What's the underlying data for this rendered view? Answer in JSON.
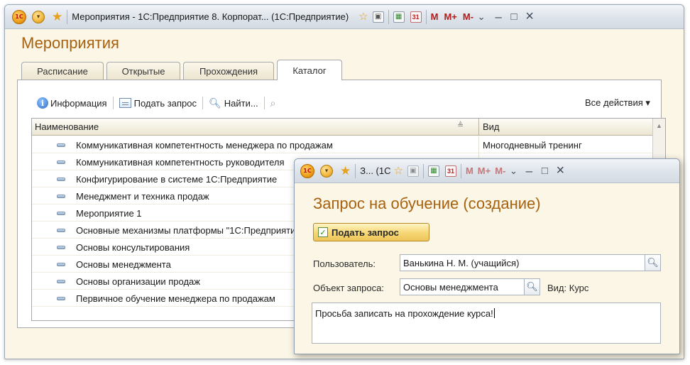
{
  "main_window": {
    "title": "Мероприятия - 1С:Предприятие 8. Корпорат...  (1С:Предприятие)",
    "logo_text": "1С",
    "toolbar_icons": [
      "calculator-icon",
      "calendar-icon"
    ],
    "memory": {
      "m": "M",
      "m_plus": "M+",
      "m_minus": "M-"
    },
    "window_controls": {
      "dropdown": "⌄",
      "minimize": "–",
      "maximize": "□",
      "close": "×"
    }
  },
  "page": {
    "title": "Мероприятия",
    "tabs": [
      {
        "label": "Расписание",
        "active": false
      },
      {
        "label": "Открытые",
        "active": false
      },
      {
        "label": "Прохождения",
        "active": false
      },
      {
        "label": "Каталог",
        "active": true
      }
    ]
  },
  "toolbar": {
    "info_label": "Информация",
    "request_label": "Подать запрос",
    "find_label": "Найти...",
    "all_actions_label": "Все действия ▾"
  },
  "grid": {
    "columns": {
      "name": "Наименование",
      "kind": "Вид"
    },
    "rows": [
      {
        "name": "Коммуникативная компетентность менеджера по продажам",
        "kind": "Многодневный тренинг"
      },
      {
        "name": "Коммуникативная компетентность руководителя",
        "kind": ""
      },
      {
        "name": "Конфигурирование в системе 1С:Предприятие",
        "kind": ""
      },
      {
        "name": "Менеджмент и техника продаж",
        "kind": ""
      },
      {
        "name": "Мероприятие 1",
        "kind": ""
      },
      {
        "name": "Основные механизмы платформы \"1С:Предприятие\"",
        "kind": ""
      },
      {
        "name": "Основы консультирования",
        "kind": ""
      },
      {
        "name": "Основы менеджмента",
        "kind": ""
      },
      {
        "name": "Основы организации продаж",
        "kind": ""
      },
      {
        "name": "Первичное обучение менеджера по продажам",
        "kind": ""
      }
    ]
  },
  "dialog": {
    "window_title": "З...  (1С",
    "title": "Запрос на обучение (создание)",
    "submit_label": "Подать запрос",
    "user_label": "Пользователь:",
    "user_value": "Ванькина Н. М. (учащийся)",
    "object_label": "Объект запроса:",
    "object_value": "Основы менеджмента",
    "kind_text": "Вид: Курс",
    "comment": "Просьба записать на прохождение курса!"
  }
}
